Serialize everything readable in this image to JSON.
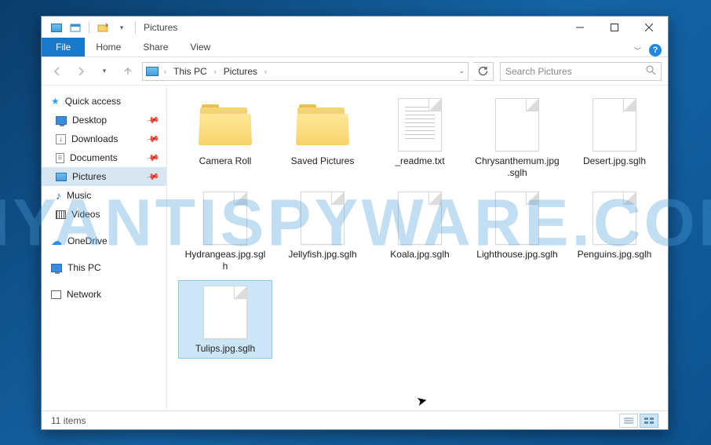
{
  "watermark": "MYANTISPYWARE.COM",
  "title": "Pictures",
  "ribbon": {
    "file": "File",
    "home": "Home",
    "share": "Share",
    "view": "View"
  },
  "breadcrumb": {
    "root": "This PC",
    "current": "Pictures"
  },
  "search_placeholder": "Search Pictures",
  "sidebar": {
    "quick_access": "Quick access",
    "desktop": "Desktop",
    "downloads": "Downloads",
    "documents": "Documents",
    "pictures": "Pictures",
    "music": "Music",
    "videos": "Videos",
    "onedrive": "OneDrive",
    "this_pc": "This PC",
    "network": "Network"
  },
  "items": {
    "i0": "Camera Roll",
    "i1": "Saved Pictures",
    "i2": "_readme.txt",
    "i3": "Chrysanthemum.jpg.sglh",
    "i4": "Desert.jpg.sglh",
    "i5": "Hydrangeas.jpg.sglh",
    "i6": "Jellyfish.jpg.sglh",
    "i7": "Koala.jpg.sglh",
    "i8": "Lighthouse.jpg.sglh",
    "i9": "Penguins.jpg.sglh",
    "i10": "Tulips.jpg.sglh"
  },
  "status": "11 items"
}
